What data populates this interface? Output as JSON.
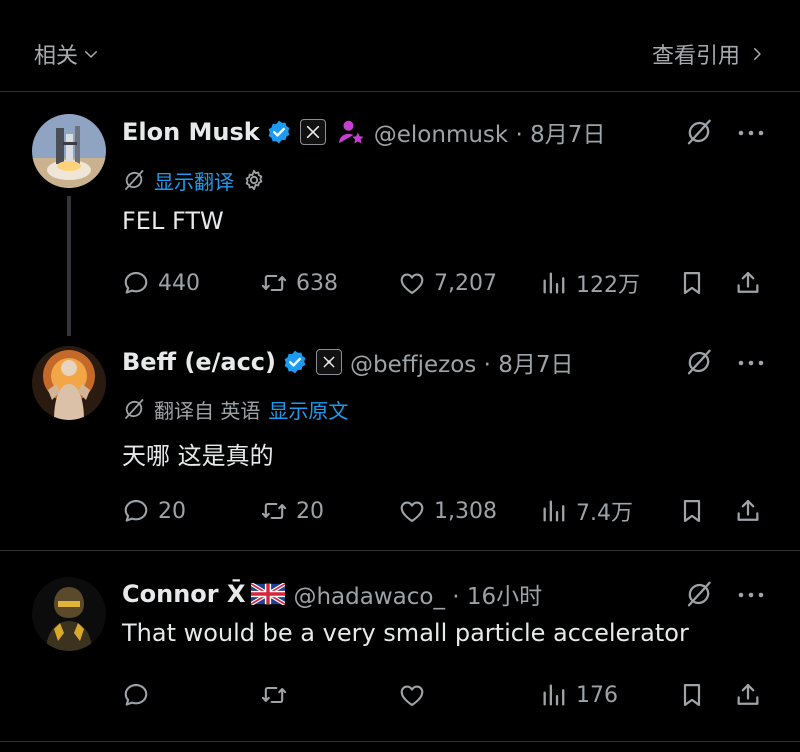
{
  "topbar": {
    "left_label": "相关",
    "right_label": "查看引用"
  },
  "colors": {
    "accent": "#1d9bf0",
    "background": "#000000",
    "muted": "#9ea3a8"
  },
  "tweets": [
    {
      "name": "Elon Musk",
      "handle": "@elonmusk · 8月7日",
      "translate": {
        "gray": "",
        "blue": "显示翻译"
      },
      "text": "FEL FTW",
      "replies": "440",
      "reposts": "638",
      "likes": "7,207",
      "views": "122万"
    },
    {
      "name": "Beff (e/acc)",
      "handle": "@beffjezos · 8月7日",
      "translate": {
        "gray": "翻译自 英语",
        "blue": "显示原文"
      },
      "text": "天哪 这是真的",
      "replies": "20",
      "reposts": "20",
      "likes": "1,308",
      "views": "7.4万"
    },
    {
      "name": "Connor X̄",
      "handle": "@hadawaco_ · 16小时",
      "text": "That would be a very small particle accelerator",
      "replies": "",
      "reposts": "",
      "likes": "",
      "views": "176"
    }
  ]
}
